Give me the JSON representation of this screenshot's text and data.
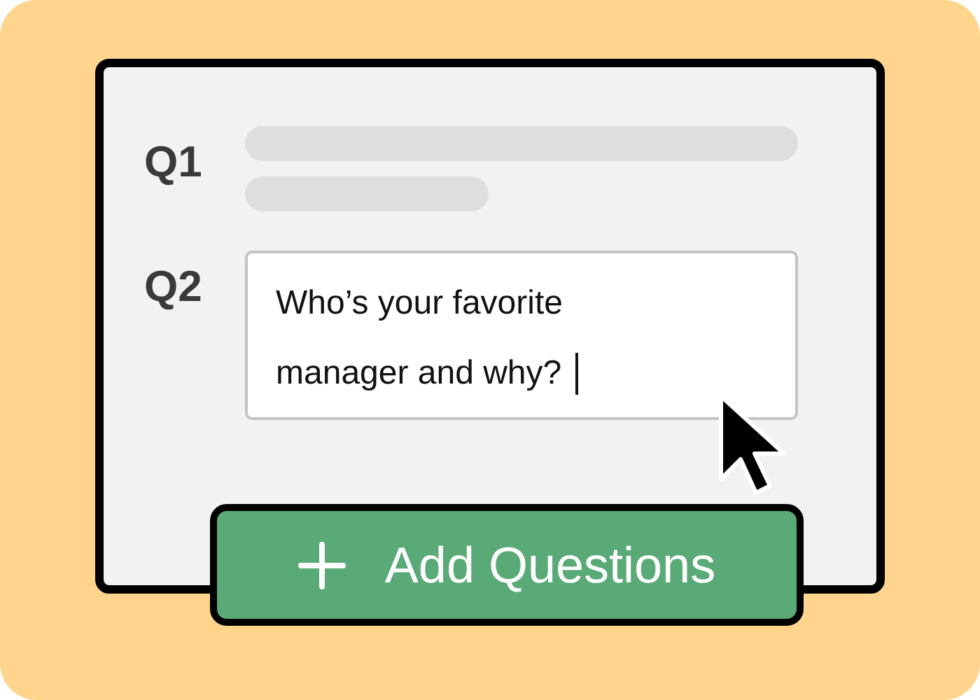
{
  "questions": [
    {
      "label": "Q1",
      "kind": "skeleton"
    },
    {
      "label": "Q2",
      "kind": "field",
      "value": "Who’s your favorite manager and why?",
      "focused": true
    }
  ],
  "button": {
    "label": "Add Questions"
  }
}
